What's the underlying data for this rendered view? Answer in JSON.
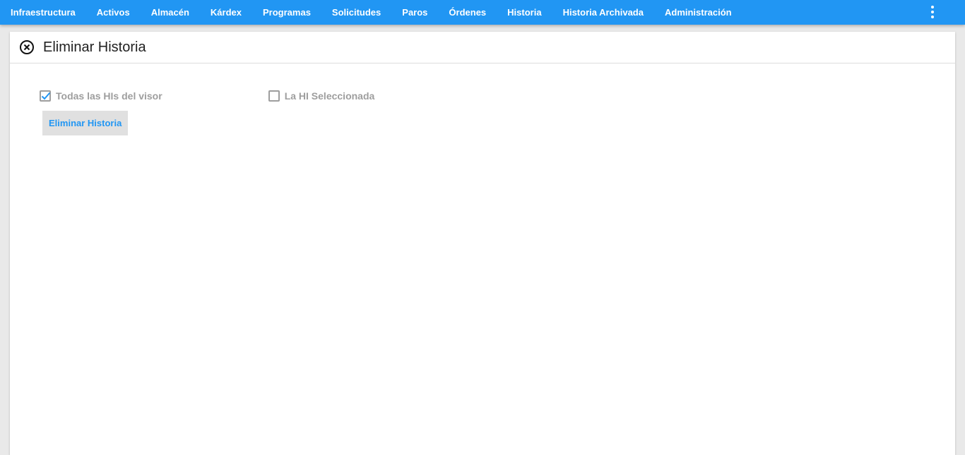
{
  "nav": {
    "items": [
      "Infraestructura",
      "Activos",
      "Almacén",
      "Kárdex",
      "Programas",
      "Solicitudes",
      "Paros",
      "Órdenes",
      "Historia",
      "Historia Archivada",
      "Administración"
    ],
    "more_icon": "more-vertical-icon",
    "background": "#2196f3"
  },
  "card": {
    "title": "Eliminar Historia",
    "close_icon": "close-circle-icon",
    "options": [
      {
        "label": "Todas las HIs del visor",
        "checked": true
      },
      {
        "label": "La HI Seleccionada",
        "checked": false
      }
    ],
    "action_button": "Eliminar Historia"
  },
  "colors": {
    "accent": "#2196f3",
    "muted_text": "#9e9e9e",
    "button_bg": "#e0e0e0"
  }
}
